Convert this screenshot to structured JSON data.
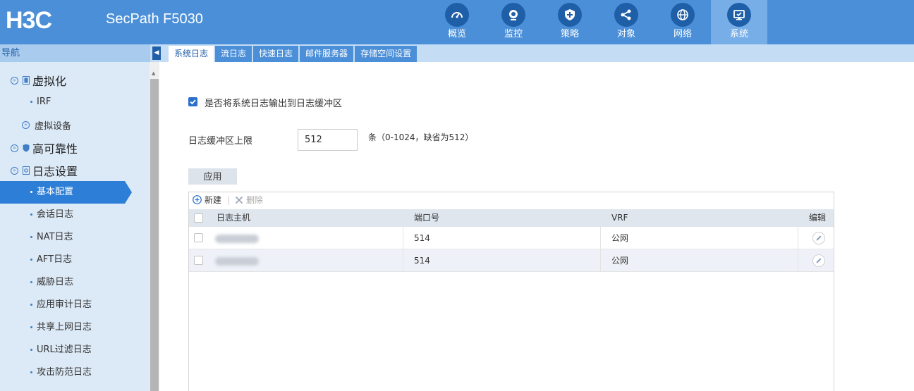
{
  "brand": {
    "logo": "H3C",
    "product": "SecPath F5030"
  },
  "topnav": [
    {
      "label": "概览",
      "icon": "speedometer-icon"
    },
    {
      "label": "监控",
      "icon": "camera-icon"
    },
    {
      "label": "策略",
      "icon": "shield-plus-icon"
    },
    {
      "label": "对象",
      "icon": "share-icon"
    },
    {
      "label": "网络",
      "icon": "globe-icon"
    },
    {
      "label": "系统",
      "icon": "monitor-icon",
      "active": true
    }
  ],
  "nav_title": "导航",
  "subtabs": [
    "系统日志",
    "流日志",
    "快速日志",
    "邮件服务器",
    "存储空间设置"
  ],
  "active_subtab": "系统日志",
  "sidebar": {
    "groups": [
      {
        "label": "虚拟化"
      },
      {
        "label": "高可靠性"
      },
      {
        "label": "日志设置"
      }
    ],
    "irf": "IRF",
    "virtual_device": "虚拟设备",
    "log_items": [
      "基本配置",
      "会话日志",
      "NAT日志",
      "AFT日志",
      "威胁日志",
      "应用审计日志",
      "共享上网日志",
      "URL过滤日志",
      "攻击防范日志"
    ],
    "active_item": "基本配置"
  },
  "form": {
    "buffer_checkbox_label": "是否将系统日志输出到日志缓冲区",
    "buffer_checked": true,
    "limit_label": "日志缓冲区上限",
    "limit_value": "512",
    "limit_hint": "条（0-1024，缺省为512）",
    "apply_label": "应用"
  },
  "table": {
    "toolbar": {
      "new_label": "新建",
      "delete_label": "删除"
    },
    "columns": [
      "日志主机",
      "端口号",
      "VRF",
      "编辑"
    ],
    "rows": [
      {
        "host": "",
        "port": "514",
        "vrf": "公网"
      },
      {
        "host": "",
        "port": "514",
        "vrf": "公网"
      }
    ]
  },
  "colors": {
    "header_bg": "#4b8fd8",
    "accent": "#2d7ed6",
    "icon_circle": "#1f5fa8"
  }
}
